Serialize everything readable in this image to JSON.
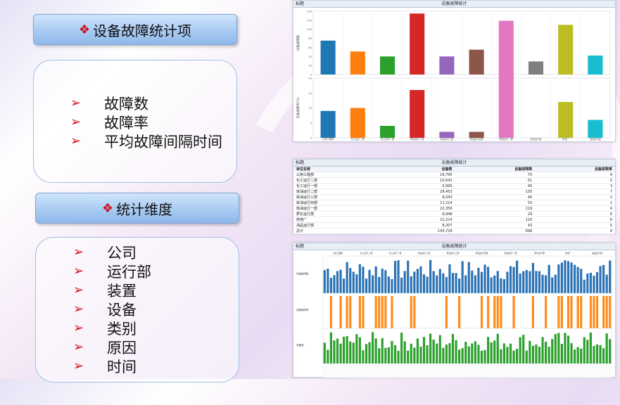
{
  "slide": {
    "section1": {
      "mark": "❖",
      "title": "设备故障统计项",
      "items": [
        "故障数",
        "故障率",
        "平均故障间隔时间"
      ]
    },
    "section2": {
      "mark": "❖",
      "title": "统计维度",
      "items": [
        "公司",
        "运行部",
        "装置",
        "设备",
        "类别",
        "原因",
        "时间"
      ]
    },
    "bullet_icon": "red-arrow-bullet-icon"
  },
  "panel1": {
    "label": "标题",
    "title": "设备故障统计",
    "top_ylabel": "设备故障数",
    "bottom_ylabel": "设备故障率(%)",
    "top_yticks": [
      "140",
      "120",
      "100",
      "80",
      "60",
      "40",
      "20",
      "0"
    ],
    "bottom_yticks": [
      "20",
      "15",
      "10",
      "5",
      "0"
    ]
  },
  "panel2": {
    "label": "标题",
    "title": "设备故障统计",
    "headers": [
      "单位名称",
      "设备数",
      "设备故障数",
      "设备故障率"
    ],
    "rows": [
      [
        "公用工程部",
        "16,795",
        "75",
        "4"
      ],
      [
        "化工运行二部",
        "10,641",
        "51",
        "5"
      ],
      [
        "化工运行一部",
        "5,995",
        "40",
        "3"
      ],
      [
        "炼油运行二部",
        "29,453",
        "135",
        "7"
      ],
      [
        "炼油运行三部",
        "8,543",
        "40",
        "1"
      ],
      [
        "炼油运行四部",
        "11,214",
        "55",
        "1"
      ],
      [
        "炼油运行一部",
        "22,356",
        "119",
        "9"
      ],
      [
        "质化运行部",
        "6,948",
        "29",
        "6"
      ],
      [
        "热电厂",
        "21,214",
        "110",
        "6"
      ],
      [
        "油品运行部",
        "8,207",
        "42",
        "5"
      ],
      [
        "总计",
        "143,726",
        "696",
        "4"
      ]
    ]
  },
  "panel3": {
    "label": "标题",
    "title": "设备故障统计",
    "row_labels": [
      "设备故障数",
      "设备故障率",
      "设备数"
    ],
    "header_groups": [
      "公用工程部",
      "化工运行二部",
      "化工运行一部",
      "炼油运行二部",
      "炼油运行三部",
      "炼油运行四部",
      "炼油运行一部",
      "质化运行部",
      "热电厂",
      "油品运行部"
    ]
  },
  "chart_data": [
    {
      "type": "bar",
      "title": "设备故障统计",
      "categories": [
        "公用工程部",
        "化工运行二部",
        "化工运行一部",
        "炼油运行二部",
        "炼油运行三部",
        "炼油运行四部",
        "炼油运行一部",
        "质化运行部",
        "热电厂",
        "油品运行部"
      ],
      "colors": [
        "#1f77b4",
        "#ff7f0e",
        "#2ca02c",
        "#d62728",
        "#9467bd",
        "#8c564b",
        "#e377c2",
        "#7f7f7f",
        "#bcbd22",
        "#17becf"
      ],
      "series": [
        {
          "name": "设备故障数",
          "values": [
            75,
            51,
            40,
            135,
            40,
            55,
            119,
            29,
            110,
            42
          ],
          "ylim": [
            0,
            140
          ]
        },
        {
          "name": "设备故障率(%)",
          "values": [
            9,
            10,
            4,
            16,
            2,
            2,
            22,
            0,
            12,
            6
          ],
          "ylim": [
            0,
            20
          ]
        }
      ]
    }
  ],
  "colors": {
    "accent_red": "#d8101a",
    "title_blue": "#a9cbf2",
    "bar_blue": "#2b72b5",
    "bar_orange": "#ff8c1a",
    "bar_green": "#2ca02c"
  }
}
